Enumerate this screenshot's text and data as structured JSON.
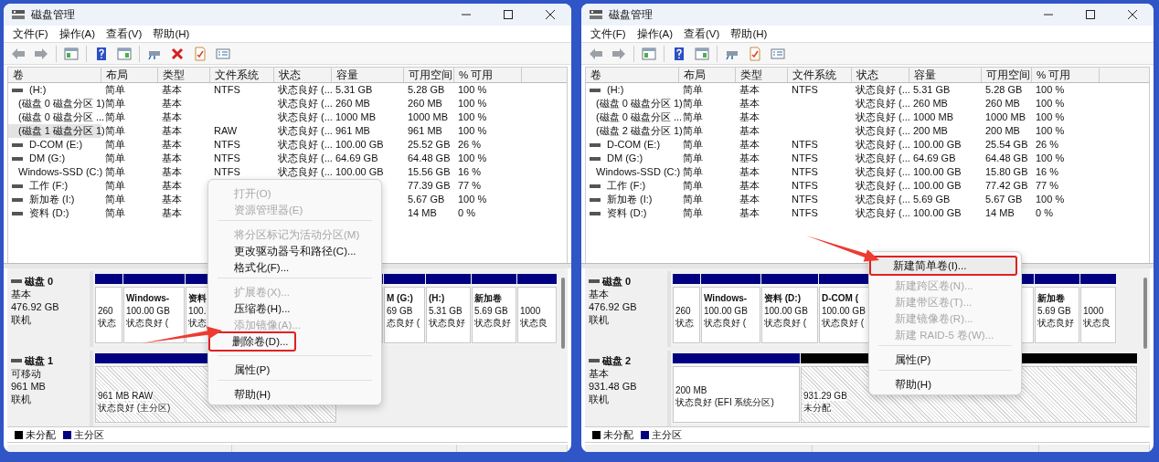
{
  "windows": [
    {
      "title": "磁盘管理",
      "menu": [
        "文件(F)",
        "操作(A)",
        "查看(V)",
        "帮助(H)"
      ],
      "toolbar": [
        {
          "kind": "back"
        },
        {
          "kind": "forward"
        },
        {
          "kind": "separator"
        },
        {
          "kind": "tree"
        },
        {
          "kind": "separator"
        },
        {
          "kind": "help"
        },
        {
          "kind": "pane"
        },
        {
          "kind": "separator"
        },
        {
          "kind": "connect"
        },
        {
          "kind": "delete"
        },
        {
          "kind": "check"
        },
        {
          "kind": "list"
        }
      ],
      "table": {
        "columns": [
          "卷",
          "布局",
          "类型",
          "文件系统",
          "状态",
          "容量",
          "可用空间",
          "% 可用"
        ],
        "rows": [
          {
            "volume": "(H:)",
            "layout": "简单",
            "type": "基本",
            "file_system": "NTFS",
            "status": "状态良好 (...",
            "capacity": "5.31 GB",
            "free_space": "5.28 GB",
            "percent_free": "100 %",
            "selected": false
          },
          {
            "volume": "(磁盘 0 磁盘分区 1)",
            "layout": "简单",
            "type": "基本",
            "status": "状态良好 (...",
            "capacity": "260 MB",
            "free_space": "260 MB",
            "percent_free": "100 %",
            "selected": false
          },
          {
            "volume": "(磁盘 0 磁盘分区 ...",
            "layout": "简单",
            "type": "基本",
            "status": "状态良好 (...",
            "capacity": "1000 MB",
            "free_space": "1000 MB",
            "percent_free": "100 %",
            "selected": false
          },
          {
            "volume": "(磁盘 1 磁盘分区 1)",
            "layout": "简单",
            "type": "基本",
            "file_system": "RAW",
            "status": "状态良好 (...",
            "capacity": "961 MB",
            "free_space": "961 MB",
            "percent_free": "100 %",
            "selected": true
          },
          {
            "volume": "D-COM (E:)",
            "layout": "简单",
            "type": "基本",
            "file_system": "NTFS",
            "status": "状态良好 (...",
            "capacity": "100.00 GB",
            "free_space": "25.52 GB",
            "percent_free": "26 %",
            "selected": false
          },
          {
            "volume": "DM (G:)",
            "layout": "简单",
            "type": "基本",
            "file_system": "NTFS",
            "status": "状态良好 (...",
            "capacity": "64.69 GB",
            "free_space": "64.48 GB",
            "percent_free": "100 %",
            "selected": false
          },
          {
            "volume": "Windows-SSD (C:)",
            "layout": "简单",
            "type": "基本",
            "file_system": "NTFS",
            "status": "状态良好 (...",
            "capacity": "100.00 GB",
            "free_space": "15.56 GB",
            "percent_free": "16 %",
            "selected": false
          },
          {
            "volume": "工作 (F:)",
            "layout": "简单",
            "type": "基本",
            "free_space": "77.39 GB",
            "percent_free": "77 %",
            "selected": false
          },
          {
            "volume": "新加卷 (I:)",
            "layout": "简单",
            "type": "基本",
            "free_space": "5.67 GB",
            "percent_free": "100 %",
            "selected": false
          },
          {
            "volume": "资料 (D:)",
            "layout": "简单",
            "type": "基本",
            "free_space": "14 MB",
            "percent_free": "0 %",
            "selected": false
          }
        ]
      },
      "disks": [
        {
          "name": "磁盘 0",
          "type": "基本",
          "size": "476.92 GB",
          "status": "联机",
          "partitions": [
            {
              "kind": "primary",
              "size": "260",
              "status": "状态",
              "selected": false
            },
            {
              "kind": "primary",
              "name": "Windows-",
              "size": "100.00 GB",
              "status": "状态良好 (",
              "selected": false
            },
            {
              "kind": "primary",
              "name": "资料",
              "size": "100.",
              "status": "状态",
              "selected": false
            },
            {
              "kind": "primary",
              "name": "M (G:)",
              "size": "69 GB",
              "status": "态良好 (",
              "selected": false
            },
            {
              "kind": "primary",
              "name": "(H:)",
              "size": "5.31 GB",
              "status": "状态良好",
              "selected": false
            },
            {
              "kind": "primary",
              "name": "新加卷",
              "size": "5.69 GB",
              "status": "状态良好",
              "selected": false
            },
            {
              "kind": "primary",
              "size": "1000",
              "status": "状态良",
              "selected": false
            }
          ]
        },
        {
          "name": "磁盘 1",
          "type": "可移动",
          "size": "961 MB",
          "status": "联机",
          "partitions": [
            {
              "kind": "primary",
              "size": "961 MB RAW",
              "status": "状态良好 (主分区)",
              "selected": true
            }
          ]
        }
      ],
      "legend": [
        {
          "label": "未分配",
          "color": "#000000"
        },
        {
          "label": "主分区",
          "color": "#000080"
        }
      ],
      "context_menu": [
        {
          "kind": "item",
          "label": "打开(O)",
          "disabled": true,
          "highlighted": false,
          "annotated": false
        },
        {
          "kind": "item",
          "label": "资源管理器(E)",
          "disabled": true,
          "highlighted": false,
          "annotated": false
        },
        {
          "kind": "separator"
        },
        {
          "kind": "item",
          "label": "将分区标记为活动分区(M)",
          "disabled": true,
          "highlighted": false,
          "annotated": false
        },
        {
          "kind": "item",
          "label": "更改驱动器号和路径(C)...",
          "disabled": false,
          "highlighted": false,
          "annotated": false
        },
        {
          "kind": "item",
          "label": "格式化(F)...",
          "disabled": false,
          "highlighted": false,
          "annotated": false
        },
        {
          "kind": "separator"
        },
        {
          "kind": "item",
          "label": "扩展卷(X)...",
          "disabled": true,
          "highlighted": false,
          "annotated": false
        },
        {
          "kind": "item",
          "label": "压缩卷(H)...",
          "disabled": false,
          "highlighted": false,
          "annotated": false
        },
        {
          "kind": "item",
          "label": "添加镜像(A)...",
          "disabled": true,
          "highlighted": false,
          "annotated": false
        },
        {
          "kind": "item",
          "label": "删除卷(D)...",
          "disabled": false,
          "highlighted": false,
          "annotated": true
        },
        {
          "kind": "separator"
        },
        {
          "kind": "item",
          "label": "属性(P)",
          "disabled": false,
          "highlighted": false,
          "annotated": false
        },
        {
          "kind": "separator"
        },
        {
          "kind": "item",
          "label": "帮助(H)",
          "disabled": false,
          "highlighted": false,
          "annotated": false
        }
      ],
      "arrow": true
    },
    {
      "title": "磁盘管理",
      "menu": [
        "文件(F)",
        "操作(A)",
        "查看(V)",
        "帮助(H)"
      ],
      "toolbar": [
        {
          "kind": "back"
        },
        {
          "kind": "forward"
        },
        {
          "kind": "separator"
        },
        {
          "kind": "tree"
        },
        {
          "kind": "separator"
        },
        {
          "kind": "help"
        },
        {
          "kind": "pane"
        },
        {
          "kind": "separator"
        },
        {
          "kind": "connect"
        },
        {
          "kind": "check"
        },
        {
          "kind": "list"
        }
      ],
      "table": {
        "columns": [
          "卷",
          "布局",
          "类型",
          "文件系统",
          "状态",
          "容量",
          "可用空间",
          "% 可用"
        ],
        "rows": [
          {
            "volume": "(H:)",
            "layout": "简单",
            "type": "基本",
            "file_system": "NTFS",
            "status": "状态良好 (...",
            "capacity": "5.31 GB",
            "free_space": "5.28 GB",
            "percent_free": "100 %",
            "selected": false
          },
          {
            "volume": "(磁盘 0 磁盘分区 1)",
            "layout": "简单",
            "type": "基本",
            "status": "状态良好 (...",
            "capacity": "260 MB",
            "free_space": "260 MB",
            "percent_free": "100 %",
            "selected": false
          },
          {
            "volume": "(磁盘 0 磁盘分区 ...",
            "layout": "简单",
            "type": "基本",
            "status": "状态良好 (...",
            "capacity": "1000 MB",
            "free_space": "1000 MB",
            "percent_free": "100 %",
            "selected": false
          },
          {
            "volume": "(磁盘 2 磁盘分区 1)",
            "layout": "简单",
            "type": "基本",
            "status": "状态良好 (...",
            "capacity": "200 MB",
            "free_space": "200 MB",
            "percent_free": "100 %",
            "selected": false
          },
          {
            "volume": "D-COM (E:)",
            "layout": "简单",
            "type": "基本",
            "file_system": "NTFS",
            "status": "状态良好 (...",
            "capacity": "100.00 GB",
            "free_space": "25.54 GB",
            "percent_free": "26 %",
            "selected": false
          },
          {
            "volume": "DM (G:)",
            "layout": "简单",
            "type": "基本",
            "file_system": "NTFS",
            "status": "状态良好 (...",
            "capacity": "64.69 GB",
            "free_space": "64.48 GB",
            "percent_free": "100 %",
            "selected": false
          },
          {
            "volume": "Windows-SSD (C:)",
            "layout": "简单",
            "type": "基本",
            "file_system": "NTFS",
            "status": "状态良好 (...",
            "capacity": "100.00 GB",
            "free_space": "15.80 GB",
            "percent_free": "16 %",
            "selected": false
          },
          {
            "volume": "工作 (F:)",
            "layout": "简单",
            "type": "基本",
            "file_system": "NTFS",
            "status": "状态良好 (...",
            "capacity": "100.00 GB",
            "free_space": "77.42 GB",
            "percent_free": "77 %",
            "selected": false
          },
          {
            "volume": "新加卷 (I:)",
            "layout": "简单",
            "type": "基本",
            "file_system": "NTFS",
            "status": "状态良好 (...",
            "capacity": "5.69 GB",
            "free_space": "5.67 GB",
            "percent_free": "100 %",
            "selected": false
          },
          {
            "volume": "资料 (D:)",
            "layout": "简单",
            "type": "基本",
            "file_system": "NTFS",
            "status": "状态良好 (...",
            "capacity": "100.00 GB",
            "free_space": "14 MB",
            "percent_free": "0 %",
            "selected": false
          }
        ]
      },
      "disks": [
        {
          "name": "磁盘 0",
          "type": "基本",
          "size": "476.92 GB",
          "status": "联机",
          "partitions": [
            {
              "kind": "primary",
              "size": "260",
              "status": "状态",
              "selected": false
            },
            {
              "kind": "primary",
              "name": "Windows-",
              "size": "100.00 GB",
              "status": "状态良好 (",
              "selected": false
            },
            {
              "kind": "primary",
              "name": "资料 (D:)",
              "size": "100.00 GB",
              "status": "状态良好 (",
              "selected": false
            },
            {
              "kind": "primary",
              "name": "D-COM (",
              "size": "100.00 GB",
              "status": "状态良好 (",
              "selected": false
            },
            {
              "kind": "primary",
              "name": "新加卷",
              "size": "5.69 GB",
              "status": "状态良好",
              "selected": false
            },
            {
              "kind": "primary",
              "size": "1000",
              "status": "状态良",
              "selected": false
            }
          ]
        },
        {
          "name": "磁盘 2",
          "type": "基本",
          "size": "931.48 GB",
          "status": "联机",
          "partitions": [
            {
              "kind": "primary",
              "size": "200 MB",
              "status": "状态良好 (EFI 系统分区)",
              "selected": false
            },
            {
              "kind": "unallocated",
              "size": "931.29 GB",
              "status": "未分配",
              "selected": true
            }
          ]
        }
      ],
      "legend": [
        {
          "label": "未分配",
          "color": "#000000"
        },
        {
          "label": "主分区",
          "color": "#000080"
        }
      ],
      "context_menu": [
        {
          "kind": "item",
          "label": "新建简单卷(I)...",
          "disabled": false,
          "highlighted": true,
          "annotated": true
        },
        {
          "kind": "item",
          "label": "新建跨区卷(N)...",
          "disabled": true,
          "highlighted": false,
          "annotated": false
        },
        {
          "kind": "item",
          "label": "新建带区卷(T)...",
          "disabled": true,
          "highlighted": false,
          "annotated": false
        },
        {
          "kind": "item",
          "label": "新建镜像卷(R)...",
          "disabled": true,
          "highlighted": false,
          "annotated": false
        },
        {
          "kind": "item",
          "label": "新建 RAID-5 卷(W)...",
          "disabled": true,
          "highlighted": false,
          "annotated": false
        },
        {
          "kind": "separator"
        },
        {
          "kind": "item",
          "label": "属性(P)",
          "disabled": false,
          "highlighted": false,
          "annotated": false
        },
        {
          "kind": "separator"
        },
        {
          "kind": "item",
          "label": "帮助(H)",
          "disabled": false,
          "highlighted": false,
          "annotated": false
        }
      ],
      "arrow": true
    }
  ]
}
